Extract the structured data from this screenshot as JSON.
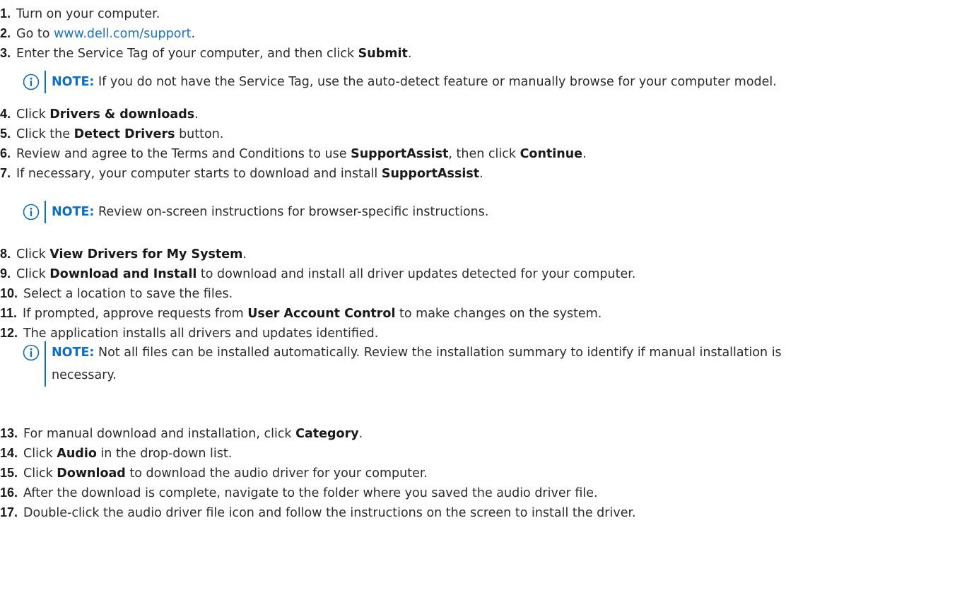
{
  "steps": [
    {
      "num": "1.",
      "parts": [
        {
          "t": "Turn on your computer."
        }
      ]
    },
    {
      "num": "2.",
      "parts": [
        {
          "t": "Go to "
        },
        {
          "t": "www.dell.com/support",
          "link": true
        },
        {
          "t": "."
        }
      ]
    },
    {
      "num": "3.",
      "parts": [
        {
          "t": "Enter the Service Tag of your computer, and then click "
        },
        {
          "t": "Submit",
          "b": true
        },
        {
          "t": "."
        }
      ]
    },
    {
      "num": "4.",
      "parts": [
        {
          "t": "Click "
        },
        {
          "t": "Drivers & downloads",
          "b": true
        },
        {
          "t": "."
        }
      ]
    },
    {
      "num": "5.",
      "parts": [
        {
          "t": "Click the "
        },
        {
          "t": "Detect Drivers",
          "b": true
        },
        {
          "t": " button."
        }
      ]
    },
    {
      "num": "6.",
      "parts": [
        {
          "t": "Review and agree to the Terms and Conditions to use "
        },
        {
          "t": "SupportAssist",
          "b": true
        },
        {
          "t": ", then click "
        },
        {
          "t": "Continue",
          "b": true
        },
        {
          "t": "."
        }
      ]
    },
    {
      "num": "7.",
      "parts": [
        {
          "t": "If necessary, your computer starts to download and install "
        },
        {
          "t": "SupportAssist",
          "b": true
        },
        {
          "t": "."
        }
      ]
    },
    {
      "num": "8.",
      "parts": [
        {
          "t": "Click "
        },
        {
          "t": "View Drivers for My System",
          "b": true
        },
        {
          "t": "."
        }
      ]
    },
    {
      "num": "9.",
      "parts": [
        {
          "t": "Click "
        },
        {
          "t": "Download and Install",
          "b": true
        },
        {
          "t": " to download and install all driver updates detected for your computer."
        }
      ]
    },
    {
      "num": "10.",
      "parts": [
        {
          "t": "Select a location to save the files."
        }
      ]
    },
    {
      "num": "11.",
      "parts": [
        {
          "t": "If prompted, approve requests from "
        },
        {
          "t": "User Account Control",
          "b": true
        },
        {
          "t": " to make changes on the system."
        }
      ]
    },
    {
      "num": "12.",
      "parts": [
        {
          "t": "The application installs all drivers and updates identified."
        }
      ]
    },
    {
      "num": "13.",
      "parts": [
        {
          "t": "For manual download and installation, click "
        },
        {
          "t": "Category",
          "b": true
        },
        {
          "t": "."
        }
      ]
    },
    {
      "num": "14.",
      "parts": [
        {
          "t": "Click "
        },
        {
          "t": "Audio",
          "b": true
        },
        {
          "t": " in the drop-down list."
        }
      ]
    },
    {
      "num": "15.",
      "parts": [
        {
          "t": "Click "
        },
        {
          "t": "Download",
          "b": true
        },
        {
          "t": " to download the audio driver for your computer."
        }
      ]
    },
    {
      "num": "16.",
      "parts": [
        {
          "t": "After the download is complete, navigate to the folder where you saved the audio driver file."
        }
      ]
    },
    {
      "num": "17.",
      "parts": [
        {
          "t": "Double-click the audio driver file icon and follow the instructions on the screen to install the driver."
        }
      ]
    }
  ],
  "notes": [
    {
      "label": "NOTE:",
      "lines": [
        "If you do not have the Service Tag, use the auto-detect feature or manually browse for your computer model."
      ]
    },
    {
      "label": "NOTE:",
      "lines": [
        "Review on-screen instructions for browser-specific instructions."
      ]
    },
    {
      "label": "NOTE:",
      "lines": [
        "Not all files can be installed automatically. Review the installation summary to identify if manual installation is",
        "necessary."
      ]
    }
  ],
  "icons": {
    "note": "info-icon"
  },
  "colors": {
    "note_accent": "#0b6ec7",
    "link": "#1a73c8",
    "text": "#2b2b2b"
  }
}
